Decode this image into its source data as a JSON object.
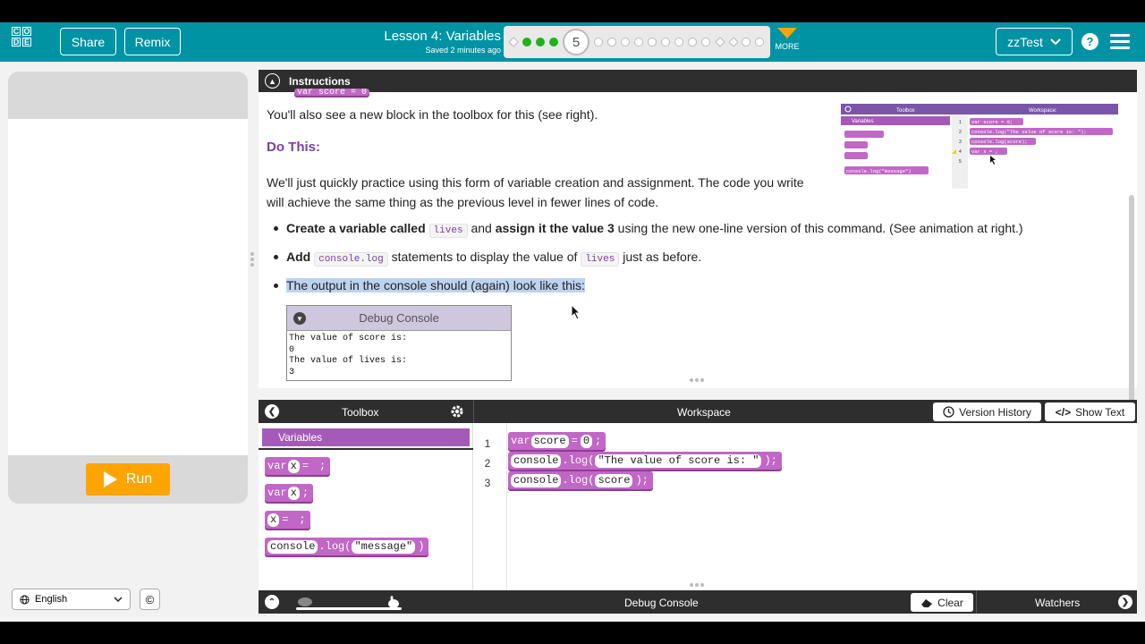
{
  "header": {
    "logo_letters": [
      "C",
      "O",
      "",
      "D",
      "E",
      ""
    ],
    "share": "Share",
    "remix": "Remix",
    "lesson_title": "Lesson 4: Variables",
    "saved": "Saved 2 minutes ago",
    "current_level": "5",
    "more": "MORE",
    "user": "zzTest",
    "help": "?"
  },
  "visual": {
    "run": "Run"
  },
  "footer": {
    "language": "English",
    "copyright": "©"
  },
  "instructions": {
    "bar_title": "Instructions",
    "partial_block": "var score = 0",
    "line1": "You'll also see a new block in the toolbox for this (see right).",
    "do_this": "Do This:",
    "para1a": "We'll just quickly practice using this form of variable creation and assignment. The code you write",
    "para1b": "will achieve the same thing as the previous level in fewer lines of code.",
    "step1": {
      "b1": "Create a variable called",
      "c1": "lives",
      "t1": "and",
      "b2": "assign it the value 3",
      "t2": "using the new one-line version of this command. (See animation at right.)"
    },
    "step2": {
      "b1": "Add",
      "c1": "console.log",
      "t1": "statements to display the value of",
      "c2": "lives",
      "t2": "just as before."
    },
    "step3": "The output in the console should (again) look like this:",
    "debug_title": "Debug Console",
    "debug_lines": [
      "The value of score is:",
      "0",
      "The value of lives is:",
      "3"
    ],
    "thumb": {
      "toolbox": "Toolbox",
      "workspace": "Workspace:",
      "variables": "Variables",
      "log": "console.log(\"message\")",
      "code1": "var score = 0;",
      "code2": "console.log(\"The value of score is: \");",
      "code3": "console.log(score);",
      "code4": "var x = ;"
    }
  },
  "editor": {
    "toolbox": "Toolbox",
    "workspace": "Workspace",
    "version_history": "Version History",
    "show_text": "Show Text",
    "category": "Variables",
    "blocks": {
      "b1": {
        "k": "var",
        "v": "x",
        "eq": "=",
        "val": " "
      },
      "b2": {
        "k": "var",
        "v": "x",
        "end": ";"
      },
      "b3": {
        "v": "x",
        "eq": "=",
        "val": " "
      },
      "b4": {
        "obj": "console",
        "fn": ".log(",
        "arg": "\"message\"",
        "end": ")"
      }
    },
    "line_numbers": [
      "1",
      "2",
      "3"
    ],
    "code": {
      "l1": {
        "k": "var",
        "v": "score",
        "eq": "=",
        "val": "0",
        "end": ";"
      },
      "l2": {
        "obj": "console",
        "fn": ".log(",
        "arg": "\"The value of score is: \"",
        "end": ");"
      },
      "l3": {
        "obj": "console",
        "fn": ".log(",
        "arg": "score",
        "end": ");"
      }
    }
  },
  "debug_bar": {
    "title": "Debug Console",
    "clear": "Clear",
    "watchers": "Watchers"
  },
  "colors": {
    "header": "#0093a4",
    "accent_run": "#ffa400",
    "block": "#c167c6",
    "category": "#a55ab8",
    "heading": "#7b3fa0"
  }
}
